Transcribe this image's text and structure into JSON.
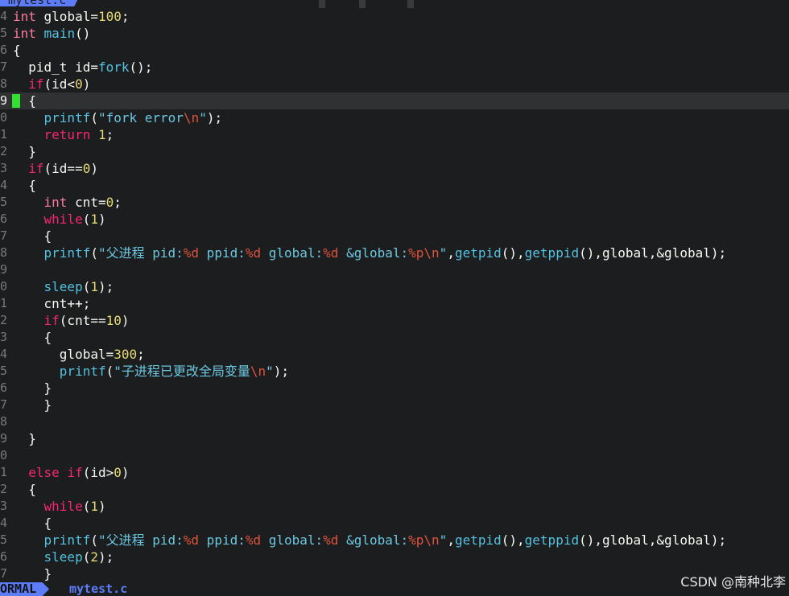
{
  "tabline": {
    "filename": "mytest.c"
  },
  "editor": {
    "lines": [
      {
        "ln": "4",
        "segs": [
          [
            "ty",
            "int"
          ],
          [
            "pl",
            " global="
          ],
          [
            "nm",
            "100"
          ],
          [
            "pl",
            ";"
          ]
        ]
      },
      {
        "ln": "5",
        "segs": [
          [
            "ty",
            "int"
          ],
          [
            "pl",
            " "
          ],
          [
            "fn",
            "main"
          ],
          [
            "pl",
            "()"
          ]
        ]
      },
      {
        "ln": "6",
        "segs": [
          [
            "pl",
            "{"
          ]
        ]
      },
      {
        "ln": "7",
        "segs": [
          [
            "pl",
            "  pid_t id="
          ],
          [
            "fn",
            "fork"
          ],
          [
            "pl",
            "();"
          ]
        ]
      },
      {
        "ln": "8",
        "segs": [
          [
            "pl",
            "  "
          ],
          [
            "kw",
            "if"
          ],
          [
            "pl",
            "(id<"
          ],
          [
            "nm",
            "0"
          ],
          [
            "pl",
            ")"
          ]
        ]
      },
      {
        "ln": "9",
        "current": true,
        "segs": [
          [
            "pl",
            "  {"
          ]
        ]
      },
      {
        "ln": "0",
        "segs": [
          [
            "pl",
            "    "
          ],
          [
            "fn",
            "printf"
          ],
          [
            "pl",
            "("
          ],
          [
            "st",
            "\"fork error"
          ],
          [
            "es",
            "\\n"
          ],
          [
            "st",
            "\""
          ],
          [
            "pl",
            ");"
          ]
        ]
      },
      {
        "ln": "1",
        "segs": [
          [
            "pl",
            "    "
          ],
          [
            "kw",
            "return"
          ],
          [
            "pl",
            " "
          ],
          [
            "nm",
            "1"
          ],
          [
            "pl",
            ";"
          ]
        ]
      },
      {
        "ln": "2",
        "segs": [
          [
            "pl",
            "  }"
          ]
        ]
      },
      {
        "ln": "3",
        "segs": [
          [
            "pl",
            "  "
          ],
          [
            "kw",
            "if"
          ],
          [
            "pl",
            "(id=="
          ],
          [
            "nm",
            "0"
          ],
          [
            "pl",
            ")"
          ]
        ]
      },
      {
        "ln": "4",
        "segs": [
          [
            "pl",
            "  {"
          ]
        ]
      },
      {
        "ln": "5",
        "segs": [
          [
            "pl",
            "    "
          ],
          [
            "ty",
            "int"
          ],
          [
            "pl",
            " cnt="
          ],
          [
            "nm",
            "0"
          ],
          [
            "pl",
            ";"
          ]
        ]
      },
      {
        "ln": "6",
        "segs": [
          [
            "pl",
            "    "
          ],
          [
            "kw",
            "while"
          ],
          [
            "pl",
            "("
          ],
          [
            "nm",
            "1"
          ],
          [
            "pl",
            ")"
          ]
        ]
      },
      {
        "ln": "7",
        "segs": [
          [
            "pl",
            "    {"
          ]
        ]
      },
      {
        "ln": "8",
        "segs": [
          [
            "pl",
            "    "
          ],
          [
            "fn",
            "printf"
          ],
          [
            "pl",
            "("
          ],
          [
            "st",
            "\"父进程 pid:"
          ],
          [
            "es",
            "%d"
          ],
          [
            "st",
            " ppid:"
          ],
          [
            "es",
            "%d"
          ],
          [
            "st",
            " global:"
          ],
          [
            "es",
            "%d"
          ],
          [
            "st",
            " &global:"
          ],
          [
            "es",
            "%p\\n"
          ],
          [
            "st",
            "\""
          ],
          [
            "pl",
            ","
          ],
          [
            "fn",
            "getpid"
          ],
          [
            "pl",
            "(),"
          ],
          [
            "fn",
            "getppid"
          ],
          [
            "pl",
            "(),global,&global);"
          ]
        ]
      },
      {
        "ln": "9",
        "segs": []
      },
      {
        "ln": "0",
        "segs": [
          [
            "pl",
            "    "
          ],
          [
            "fn",
            "sleep"
          ],
          [
            "pl",
            "("
          ],
          [
            "nm",
            "1"
          ],
          [
            "pl",
            ");"
          ]
        ]
      },
      {
        "ln": "1",
        "segs": [
          [
            "pl",
            "    cnt++;"
          ]
        ]
      },
      {
        "ln": "2",
        "segs": [
          [
            "pl",
            "    "
          ],
          [
            "kw",
            "if"
          ],
          [
            "pl",
            "(cnt=="
          ],
          [
            "nm",
            "10"
          ],
          [
            "pl",
            ")"
          ]
        ]
      },
      {
        "ln": "3",
        "segs": [
          [
            "pl",
            "    {"
          ]
        ]
      },
      {
        "ln": "4",
        "segs": [
          [
            "pl",
            "      global="
          ],
          [
            "nm",
            "300"
          ],
          [
            "pl",
            ";"
          ]
        ]
      },
      {
        "ln": "5",
        "segs": [
          [
            "pl",
            "      "
          ],
          [
            "fn",
            "printf"
          ],
          [
            "pl",
            "("
          ],
          [
            "st",
            "\"子进程已更改全局变量"
          ],
          [
            "es",
            "\\n"
          ],
          [
            "st",
            "\""
          ],
          [
            "pl",
            ");"
          ]
        ]
      },
      {
        "ln": "6",
        "segs": [
          [
            "pl",
            "    }"
          ]
        ]
      },
      {
        "ln": "7",
        "segs": [
          [
            "pl",
            "    }"
          ]
        ]
      },
      {
        "ln": "8",
        "segs": []
      },
      {
        "ln": "9",
        "segs": [
          [
            "pl",
            "  }"
          ]
        ]
      },
      {
        "ln": "0",
        "segs": []
      },
      {
        "ln": "1",
        "segs": [
          [
            "pl",
            "  "
          ],
          [
            "kw",
            "else"
          ],
          [
            "pl",
            " "
          ],
          [
            "kw",
            "if"
          ],
          [
            "pl",
            "(id>"
          ],
          [
            "nm",
            "0"
          ],
          [
            "pl",
            ")"
          ]
        ]
      },
      {
        "ln": "2",
        "segs": [
          [
            "pl",
            "  {"
          ]
        ]
      },
      {
        "ln": "3",
        "segs": [
          [
            "pl",
            "    "
          ],
          [
            "kw",
            "while"
          ],
          [
            "pl",
            "("
          ],
          [
            "nm",
            "1"
          ],
          [
            "pl",
            ")"
          ]
        ]
      },
      {
        "ln": "4",
        "segs": [
          [
            "pl",
            "    {"
          ]
        ]
      },
      {
        "ln": "5",
        "segs": [
          [
            "pl",
            "    "
          ],
          [
            "fn",
            "printf"
          ],
          [
            "pl",
            "("
          ],
          [
            "st",
            "\"父进程 pid:"
          ],
          [
            "es",
            "%d"
          ],
          [
            "st",
            " ppid:"
          ],
          [
            "es",
            "%d"
          ],
          [
            "st",
            " global:"
          ],
          [
            "es",
            "%d"
          ],
          [
            "st",
            " &global:"
          ],
          [
            "es",
            "%p\\n"
          ],
          [
            "st",
            "\""
          ],
          [
            "pl",
            ","
          ],
          [
            "fn",
            "getpid"
          ],
          [
            "pl",
            "(),"
          ],
          [
            "fn",
            "getppid"
          ],
          [
            "pl",
            "(),global,&global);"
          ]
        ]
      },
      {
        "ln": "6",
        "segs": [
          [
            "pl",
            "    "
          ],
          [
            "fn",
            "sleep"
          ],
          [
            "pl",
            "("
          ],
          [
            "nm",
            "2"
          ],
          [
            "pl",
            ");"
          ]
        ]
      },
      {
        "ln": "7",
        "segs": [
          [
            "pl",
            "    }"
          ]
        ]
      }
    ]
  },
  "statusline": {
    "mode": "ORMAL",
    "filename": "mytest.c"
  },
  "watermark": "CSDN @南种北李",
  "colors": {
    "accent": "#5c7cfa",
    "background": "#1b1d1e",
    "sign": "#32e032"
  }
}
